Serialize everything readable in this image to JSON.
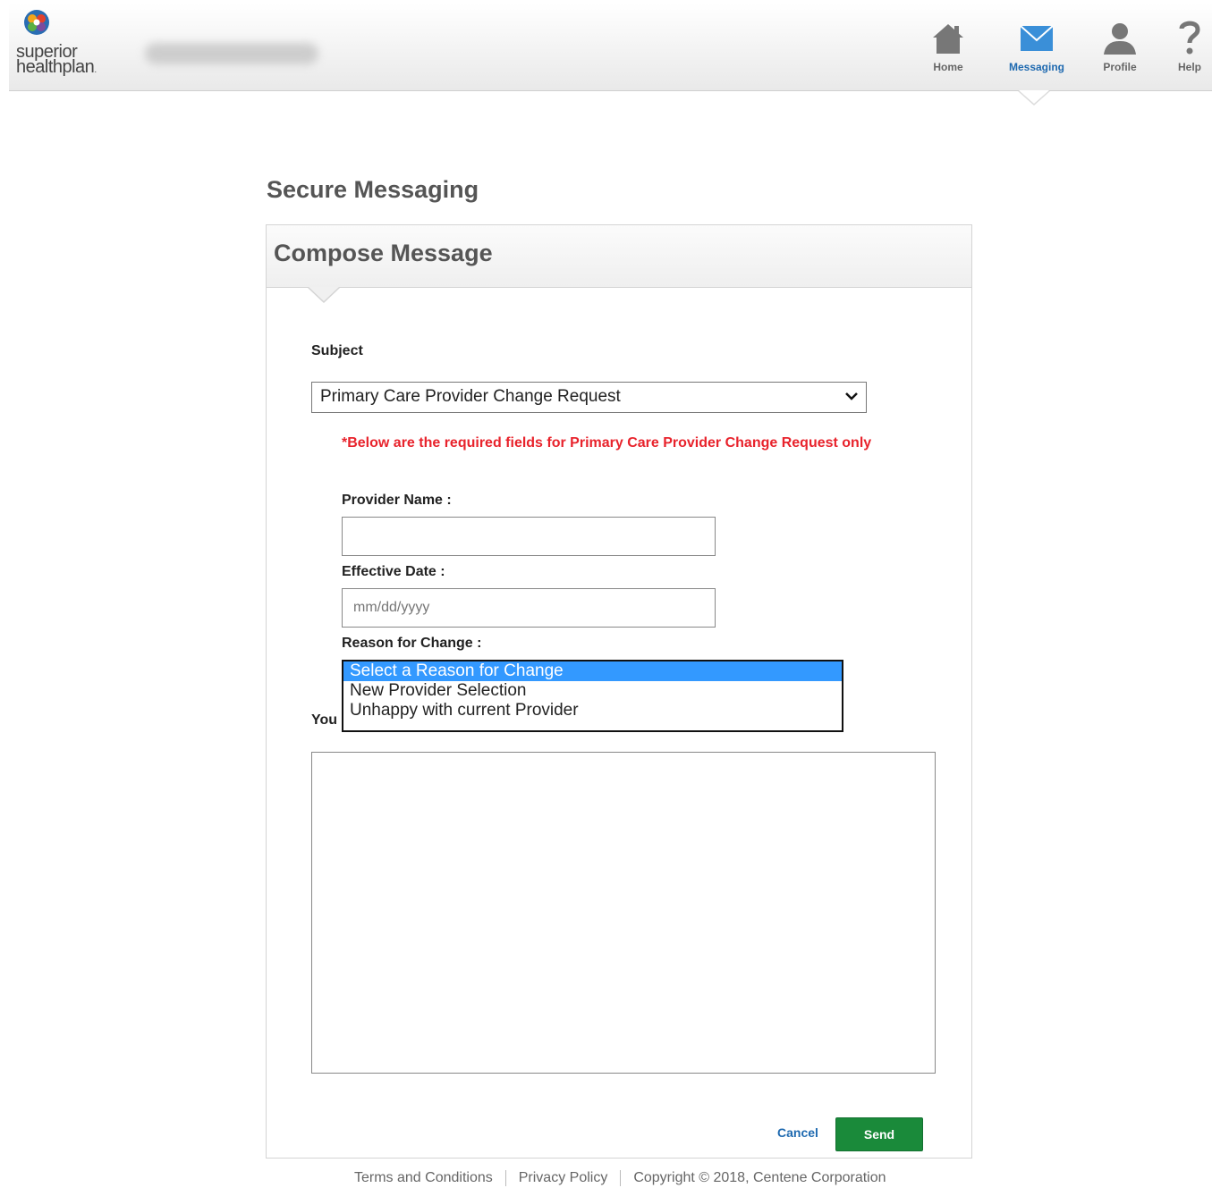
{
  "header": {
    "logo_line1": "superior",
    "logo_line2": "healthplan",
    "nav": [
      {
        "label": "Home",
        "icon": "home-icon",
        "active": false
      },
      {
        "label": "Messaging",
        "icon": "envelope-icon",
        "active": true
      },
      {
        "label": "Profile",
        "icon": "person-icon",
        "active": false
      },
      {
        "label": "Help",
        "icon": "question-icon",
        "active": false
      }
    ]
  },
  "page": {
    "title": "Secure Messaging"
  },
  "compose": {
    "title": "Compose Message",
    "subject_label": "Subject",
    "subject_value": "Primary Care Provider Change Request",
    "required_note": "*Below are the required fields for Primary Care Provider Change Request only",
    "provider_name_label": "Provider Name :",
    "provider_name_value": "",
    "effective_date_label": "Effective Date :",
    "effective_date_placeholder": "mm/dd/yyyy",
    "reason_label": "Reason for Change :",
    "reason_options": [
      "Select a Reason for Change",
      "New Provider Selection",
      "Unhappy with current Provider"
    ],
    "reason_selected_index": 0,
    "message_label_partial": "You",
    "message_value": "",
    "cancel_label": "Cancel",
    "send_label": "Send"
  },
  "footer": {
    "terms": "Terms and Conditions",
    "privacy": "Privacy Policy",
    "copyright": "Copyright © 2018, Centene Corporation"
  },
  "colors": {
    "accent_blue": "#1f6ab0",
    "send_green": "#1a8a3a",
    "required_red": "#e8232c",
    "selection_blue": "#3399ff"
  }
}
